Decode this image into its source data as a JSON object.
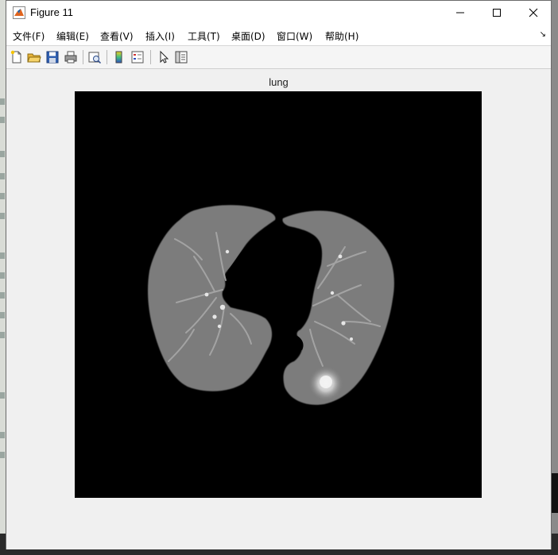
{
  "window": {
    "title": "Figure 11",
    "icon": "matlab-icon"
  },
  "menubar": {
    "items": [
      {
        "label": "文件(F)"
      },
      {
        "label": "编辑(E)"
      },
      {
        "label": "查看(V)"
      },
      {
        "label": "插入(I)"
      },
      {
        "label": "工具(T)"
      },
      {
        "label": "桌面(D)"
      },
      {
        "label": "窗口(W)"
      },
      {
        "label": "帮助(H)"
      }
    ],
    "overflow_glyph": "↘"
  },
  "toolbar": {
    "icons": [
      "new-figure-icon",
      "open-file-icon",
      "save-icon",
      "print-icon",
      "print-preview-icon",
      "colorbar-icon",
      "legend-icon",
      "select-arrow-icon",
      "property-inspector-icon"
    ]
  },
  "axes": {
    "title": "lung"
  },
  "colors": {
    "axes_background": "#000000",
    "tissue": "#7c7c7c",
    "window_bg": "#f0f0f0"
  }
}
